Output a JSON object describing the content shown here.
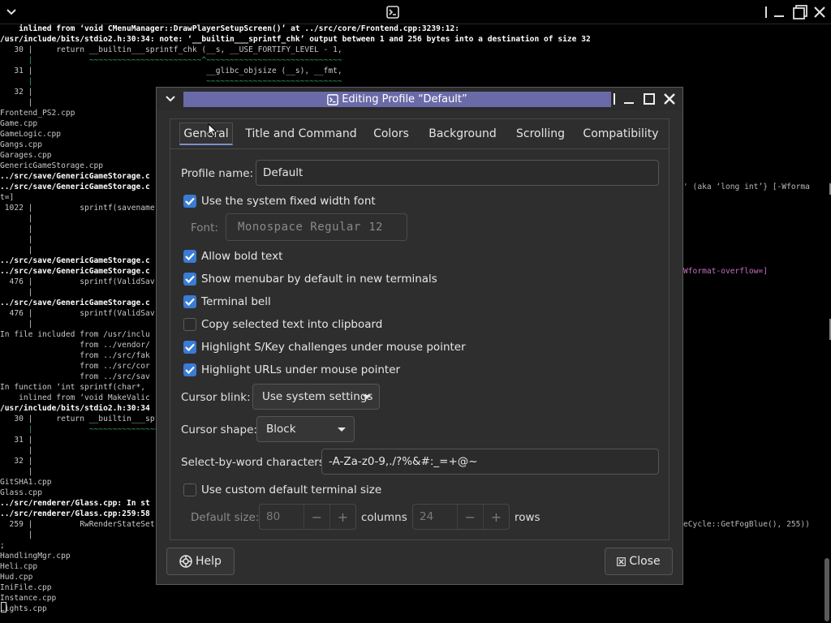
{
  "terminal": {
    "lines": [
      {
        "t": "    inlined from ‘void CMenuManager::DrawPlayerSetupScreen()’ at ../src/core/Frontend.cpp:3239:12:",
        "c": "hl"
      },
      {
        "t": "/usr/include/bits/stdio2.h:30:34: note: ‘__builtin___sprintf_chk’ output between 1 and 256 bytes into a destination of size 32",
        "c": "hl"
      },
      {
        "t": "   30 |     return __builtin___sprintf_chk (__s, __USE_FORTIFY_LEVEL - 1,",
        "c": ""
      },
      {
        "t": "      |            ~~~~~~~~~~~~~~~~~~~~~~~~^~~~~~~~~~~~~~~~~~~~~~~~~~~~~~",
        "c": "tilde"
      },
      {
        "t": "   31 |                                     __glibc_objsize (__s), __fmt,",
        "c": ""
      },
      {
        "t": "      |                                     ~~~~~~~~~~~~~~~~~~~~~~~~~~~~~",
        "c": "tilde"
      },
      {
        "t": "   32 |",
        "c": ""
      },
      {
        "t": "      |",
        "c": ""
      },
      {
        "t": "Frontend_PS2.cpp",
        "c": ""
      },
      {
        "t": "Game.cpp",
        "c": ""
      },
      {
        "t": "GameLogic.cpp",
        "c": ""
      },
      {
        "t": "Gangs.cpp",
        "c": ""
      },
      {
        "t": "Garages.cpp",
        "c": ""
      },
      {
        "t": "GenericGameStorage.cpp",
        "c": ""
      },
      {
        "t": "../src/save/GenericGameStorage.c",
        "c": "hl"
      },
      {
        "t": "../src/save/GenericGameStorage.c",
        "c": "hl"
      },
      {
        "t": "t=]",
        "c": ""
      },
      {
        "t": " 1022 |          sprintf(savename",
        "c": ""
      },
      {
        "t": "      |",
        "c": ""
      },
      {
        "t": "      |",
        "c": ""
      },
      {
        "t": "      |",
        "c": ""
      },
      {
        "t": "      |",
        "c": ""
      },
      {
        "t": "../src/save/GenericGameStorage.c",
        "c": "hl"
      },
      {
        "t": "../src/save/GenericGameStorage.c",
        "c": "hl"
      },
      {
        "t": "  476 |          sprintf(ValidSav",
        "c": ""
      },
      {
        "t": "      |",
        "c": ""
      },
      {
        "t": "../src/save/GenericGameStorage.c",
        "c": "hl"
      },
      {
        "t": "  476 |          sprintf(ValidSav",
        "c": ""
      },
      {
        "t": "      |",
        "c": ""
      },
      {
        "t": "In file included from /usr/inclu",
        "c": ""
      },
      {
        "t": "                 from ../vendor/",
        "c": ""
      },
      {
        "t": "                 from ../src/fak",
        "c": ""
      },
      {
        "t": "                 from ../src/cor",
        "c": ""
      },
      {
        "t": "                 from ../src/sav",
        "c": ""
      },
      {
        "t": "In function ‘int sprintf(char*,",
        "c": ""
      },
      {
        "t": "    inlined from ‘void MakeValic",
        "c": ""
      },
      {
        "t": "/usr/include/bits/stdio2.h:30:34",
        "c": "hl"
      },
      {
        "t": "   30 |     return __builtin___spr",
        "c": ""
      },
      {
        "t": "      |            ~~~~~~~~~~~~~~~",
        "c": "tilde"
      },
      {
        "t": "   31 |",
        "c": ""
      },
      {
        "t": "      |",
        "c": ""
      },
      {
        "t": "   32 |",
        "c": ""
      },
      {
        "t": "      |",
        "c": ""
      },
      {
        "t": "GitSHA1.cpp",
        "c": ""
      },
      {
        "t": "Glass.cpp",
        "c": ""
      },
      {
        "t": "../src/renderer/Glass.cpp: In st",
        "c": "hl"
      },
      {
        "t": "../src/renderer/Glass.cpp:259:58",
        "c": "hl"
      },
      {
        "t": "  259 |          RwRenderStateSet",
        "c": ""
      },
      {
        "t": "      |",
        "c": ""
      },
      {
        "t": ";",
        "c": ""
      },
      {
        "t": "HandlingMgr.cpp",
        "c": ""
      },
      {
        "t": "Heli.cpp",
        "c": ""
      },
      {
        "t": "Hud.cpp",
        "c": ""
      },
      {
        "t": "IniFile.cpp",
        "c": ""
      },
      {
        "t": "Instance.cpp",
        "c": ""
      },
      {
        "t": "Lights.cpp",
        "c": ""
      }
    ],
    "right_fragments": [
      {
        "row": 15,
        "t": "' (aka ‘long int’} [-Wforma",
        "c": ""
      },
      {
        "row": 23,
        "t": "Wformat-overflow=]",
        "c": "warn"
      },
      {
        "row": 47,
        "t": "eCycle::GetFogBlue(), 255))",
        "c": ""
      }
    ]
  },
  "dialog": {
    "title": "Editing Profile “Default”",
    "tabs": [
      {
        "label": "General"
      },
      {
        "label": "Title and Command"
      },
      {
        "label": "Colors"
      },
      {
        "label": "Background"
      },
      {
        "label": "Scrolling"
      },
      {
        "label": "Compatibility"
      }
    ],
    "profile_name_label": "Profile name:",
    "profile_name_value": "Default",
    "checks": [
      {
        "label": "Use the system fixed width font",
        "checked": true
      },
      {
        "label": "Allow bold text",
        "checked": true
      },
      {
        "label": "Show menubar by default in new terminals",
        "checked": true
      },
      {
        "label": "Terminal bell",
        "checked": true
      },
      {
        "label": "Copy selected text into clipboard",
        "checked": false
      },
      {
        "label": "Highlight S/Key challenges under mouse pointer",
        "checked": true
      },
      {
        "label": "Highlight URLs under mouse pointer",
        "checked": true
      },
      {
        "label": "Use custom default terminal size",
        "checked": false
      }
    ],
    "font_label": "Font:",
    "font_name": "Monospace Regular",
    "font_size": "12",
    "cursor_blink_label": "Cursor blink:",
    "cursor_blink_value": "Use system settings",
    "cursor_shape_label": "Cursor shape:",
    "cursor_shape_value": "Block",
    "select_chars_label": "Select-by-word characters:",
    "select_chars_value": "-A-Za-z0-9,./?%&#:_=+@~",
    "default_size_label": "Default size:",
    "columns_value": "80",
    "columns_label": "columns",
    "rows_value": "24",
    "rows_label": "rows",
    "help_label": "Help",
    "close_label": "Close"
  }
}
